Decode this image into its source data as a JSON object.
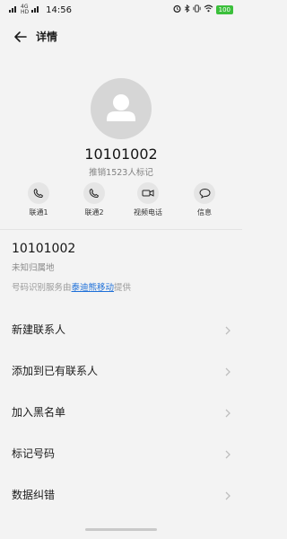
{
  "status_bar": {
    "network_top": "4G",
    "network_bottom": "HD",
    "time": "14:56",
    "battery": "100"
  },
  "header": {
    "title": "详情",
    "back_icon": "arrow-left-icon"
  },
  "contact": {
    "number": "10101002",
    "mark_info": "推销1523人标记",
    "number_secondary": "10101002",
    "location": "未知归属地",
    "provider_prefix": "号码识别服务由",
    "provider_link": "泰迪熊移动",
    "provider_suffix": "提供"
  },
  "actions": [
    {
      "label": "联通1",
      "icon": "phone-icon"
    },
    {
      "label": "联通2",
      "icon": "phone-icon"
    },
    {
      "label": "视频电话",
      "icon": "video-camera-icon"
    },
    {
      "label": "信息",
      "icon": "message-icon"
    }
  ],
  "menu": [
    {
      "label": "新建联系人"
    },
    {
      "label": "添加到已有联系人"
    },
    {
      "label": "加入黑名单"
    },
    {
      "label": "标记号码"
    },
    {
      "label": "数据纠错"
    }
  ],
  "colors": {
    "background": "#f3f3f3",
    "link": "#1d6fd8",
    "battery": "#3bbf3b"
  }
}
